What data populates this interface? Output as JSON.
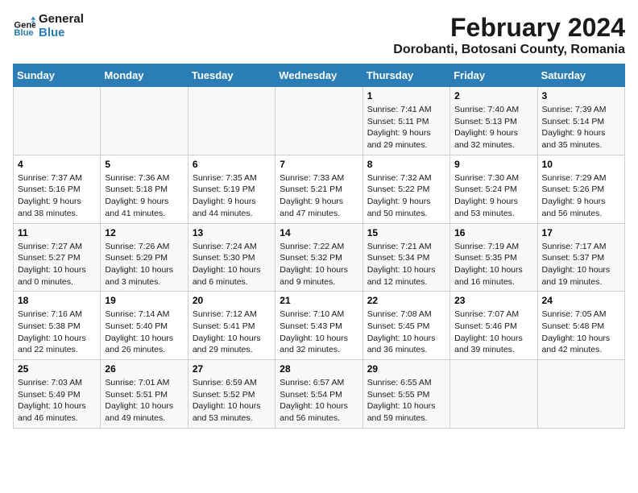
{
  "header": {
    "logo_line1": "General",
    "logo_line2": "Blue",
    "month_year": "February 2024",
    "location": "Dorobanti, Botosani County, Romania"
  },
  "days_of_week": [
    "Sunday",
    "Monday",
    "Tuesday",
    "Wednesday",
    "Thursday",
    "Friday",
    "Saturday"
  ],
  "weeks": [
    [
      {
        "day": "",
        "info": ""
      },
      {
        "day": "",
        "info": ""
      },
      {
        "day": "",
        "info": ""
      },
      {
        "day": "",
        "info": ""
      },
      {
        "day": "1",
        "info": "Sunrise: 7:41 AM\nSunset: 5:11 PM\nDaylight: 9 hours\nand 29 minutes."
      },
      {
        "day": "2",
        "info": "Sunrise: 7:40 AM\nSunset: 5:13 PM\nDaylight: 9 hours\nand 32 minutes."
      },
      {
        "day": "3",
        "info": "Sunrise: 7:39 AM\nSunset: 5:14 PM\nDaylight: 9 hours\nand 35 minutes."
      }
    ],
    [
      {
        "day": "4",
        "info": "Sunrise: 7:37 AM\nSunset: 5:16 PM\nDaylight: 9 hours\nand 38 minutes."
      },
      {
        "day": "5",
        "info": "Sunrise: 7:36 AM\nSunset: 5:18 PM\nDaylight: 9 hours\nand 41 minutes."
      },
      {
        "day": "6",
        "info": "Sunrise: 7:35 AM\nSunset: 5:19 PM\nDaylight: 9 hours\nand 44 minutes."
      },
      {
        "day": "7",
        "info": "Sunrise: 7:33 AM\nSunset: 5:21 PM\nDaylight: 9 hours\nand 47 minutes."
      },
      {
        "day": "8",
        "info": "Sunrise: 7:32 AM\nSunset: 5:22 PM\nDaylight: 9 hours\nand 50 minutes."
      },
      {
        "day": "9",
        "info": "Sunrise: 7:30 AM\nSunset: 5:24 PM\nDaylight: 9 hours\nand 53 minutes."
      },
      {
        "day": "10",
        "info": "Sunrise: 7:29 AM\nSunset: 5:26 PM\nDaylight: 9 hours\nand 56 minutes."
      }
    ],
    [
      {
        "day": "11",
        "info": "Sunrise: 7:27 AM\nSunset: 5:27 PM\nDaylight: 10 hours\nand 0 minutes."
      },
      {
        "day": "12",
        "info": "Sunrise: 7:26 AM\nSunset: 5:29 PM\nDaylight: 10 hours\nand 3 minutes."
      },
      {
        "day": "13",
        "info": "Sunrise: 7:24 AM\nSunset: 5:30 PM\nDaylight: 10 hours\nand 6 minutes."
      },
      {
        "day": "14",
        "info": "Sunrise: 7:22 AM\nSunset: 5:32 PM\nDaylight: 10 hours\nand 9 minutes."
      },
      {
        "day": "15",
        "info": "Sunrise: 7:21 AM\nSunset: 5:34 PM\nDaylight: 10 hours\nand 12 minutes."
      },
      {
        "day": "16",
        "info": "Sunrise: 7:19 AM\nSunset: 5:35 PM\nDaylight: 10 hours\nand 16 minutes."
      },
      {
        "day": "17",
        "info": "Sunrise: 7:17 AM\nSunset: 5:37 PM\nDaylight: 10 hours\nand 19 minutes."
      }
    ],
    [
      {
        "day": "18",
        "info": "Sunrise: 7:16 AM\nSunset: 5:38 PM\nDaylight: 10 hours\nand 22 minutes."
      },
      {
        "day": "19",
        "info": "Sunrise: 7:14 AM\nSunset: 5:40 PM\nDaylight: 10 hours\nand 26 minutes."
      },
      {
        "day": "20",
        "info": "Sunrise: 7:12 AM\nSunset: 5:41 PM\nDaylight: 10 hours\nand 29 minutes."
      },
      {
        "day": "21",
        "info": "Sunrise: 7:10 AM\nSunset: 5:43 PM\nDaylight: 10 hours\nand 32 minutes."
      },
      {
        "day": "22",
        "info": "Sunrise: 7:08 AM\nSunset: 5:45 PM\nDaylight: 10 hours\nand 36 minutes."
      },
      {
        "day": "23",
        "info": "Sunrise: 7:07 AM\nSunset: 5:46 PM\nDaylight: 10 hours\nand 39 minutes."
      },
      {
        "day": "24",
        "info": "Sunrise: 7:05 AM\nSunset: 5:48 PM\nDaylight: 10 hours\nand 42 minutes."
      }
    ],
    [
      {
        "day": "25",
        "info": "Sunrise: 7:03 AM\nSunset: 5:49 PM\nDaylight: 10 hours\nand 46 minutes."
      },
      {
        "day": "26",
        "info": "Sunrise: 7:01 AM\nSunset: 5:51 PM\nDaylight: 10 hours\nand 49 minutes."
      },
      {
        "day": "27",
        "info": "Sunrise: 6:59 AM\nSunset: 5:52 PM\nDaylight: 10 hours\nand 53 minutes."
      },
      {
        "day": "28",
        "info": "Sunrise: 6:57 AM\nSunset: 5:54 PM\nDaylight: 10 hours\nand 56 minutes."
      },
      {
        "day": "29",
        "info": "Sunrise: 6:55 AM\nSunset: 5:55 PM\nDaylight: 10 hours\nand 59 minutes."
      },
      {
        "day": "",
        "info": ""
      },
      {
        "day": "",
        "info": ""
      }
    ]
  ]
}
